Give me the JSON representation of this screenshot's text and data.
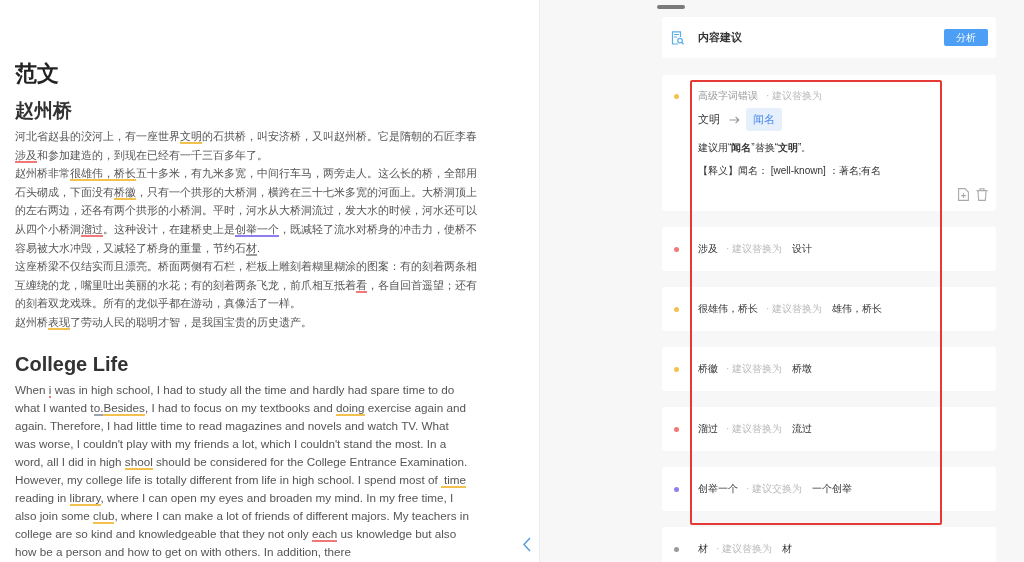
{
  "document": {
    "title": "范文",
    "sections": [
      {
        "heading": "赵州桥",
        "paragraphs": [
          {
            "segments": [
              {
                "kind": "plain",
                "text": "河北省赵县的洨河上，有一座世界"
              },
              {
                "kind": "error",
                "text": "文明",
                "color": "#f2c14e"
              },
              {
                "kind": "plain",
                "text": "的石拱桥，叫安济桥，又叫赵州桥。它是隋朝的石匠李春"
              },
              {
                "kind": "error",
                "text": "涉及",
                "color": "#f07878"
              },
              {
                "kind": "plain",
                "text": "和参加建造的，到现在已经有一千三百多年了。"
              }
            ]
          },
          {
            "segments": [
              {
                "kind": "plain",
                "text": "赵州桥非常"
              },
              {
                "kind": "error",
                "text": "很雄伟，桥长",
                "color": "#f2c14e"
              },
              {
                "kind": "plain",
                "text": "五十多米，有九米多宽，中间行车马，两旁走人。这么长的桥，全部用石头砌成，下面没有"
              },
              {
                "kind": "error",
                "text": "桥徽",
                "color": "#f2c14e"
              },
              {
                "kind": "plain",
                "text": "，只有一个拱形的大桥洞，横跨在三十七米多宽的河面上。大桥洞顶上的左右两边，还各有两个拱形的小桥洞。平时，河水从大桥洞流过，发大水的时候，河水还可以从四个小桥洞"
              },
              {
                "kind": "error",
                "text": "溜过",
                "color": "#f07878"
              },
              {
                "kind": "plain",
                "text": "。这种设计，在建桥史上是"
              },
              {
                "kind": "error",
                "text": "创举一个",
                "color": "#8f7ef0"
              },
              {
                "kind": "plain",
                "text": "，既减轻了流水对桥身的冲击力，使桥不容易被大水冲毁，又减轻了桥身的重量，节约石"
              },
              {
                "kind": "error",
                "text": "材",
                "color": "#9a9a9a"
              },
              {
                "kind": "plain",
                "text": "."
              }
            ]
          },
          {
            "segments": [
              {
                "kind": "plain",
                "text": "这座桥梁不仅结实而且漂亮。桥面两侧有石栏，栏板上雕刻着糊里糊涂的图案：有的刻着两条相互缠绕的龙，嘴里吐出美丽的水花；有的刻着两条飞龙，前爪相互抵着"
              },
              {
                "kind": "error",
                "text": "看",
                "color": "#f07878"
              },
              {
                "kind": "plain",
                "text": "，各自回首遥望；还有的刻着双龙戏珠。所有的龙似乎都在游动，真像活了一样。"
              }
            ]
          },
          {
            "segments": [
              {
                "kind": "plain",
                "text": "赵州桥"
              },
              {
                "kind": "error",
                "text": "表现",
                "color": "#f2c14e"
              },
              {
                "kind": "plain",
                "text": "了劳动人民的聪明才智，是我国宝贵的历史遗产。"
              }
            ]
          }
        ]
      },
      {
        "heading": "College Life",
        "paragraphs": [
          {
            "segments": [
              {
                "kind": "plain",
                "text": "When "
              },
              {
                "kind": "error",
                "text": "i",
                "color": "#f07878"
              },
              {
                "kind": "plain",
                "text": " was in high school, I had to study all the time and hardly had spare time to do what I wanted t"
              },
              {
                "kind": "error",
                "text": "o.",
                "color": "#9aa4b4"
              },
              {
                "kind": "error",
                "text": "Besides",
                "color": "#f2c14e"
              },
              {
                "kind": "plain",
                "text": ", I had to focus on my textbooks and "
              },
              {
                "kind": "error",
                "text": "doing",
                "color": "#f2c14e"
              },
              {
                "kind": "plain",
                "text": " exercise again and again. Therefore, I had little time to read magazines and novels and watch TV. What was worse, I couldn't play with my friends a lot, which I couldn't stand the most. In a word, all I did in high "
              },
              {
                "kind": "error",
                "text": "shool",
                "color": "#f2c14e"
              },
              {
                "kind": "plain",
                "text": " should be considered for the College Entrance Examination. However, my college life is totally different from life in high school. I spend most of "
              },
              {
                "kind": "insert",
                "color": "#f2c14e"
              },
              {
                "kind": "error",
                "text": "time",
                "color": "#f2c14e"
              },
              {
                "kind": "plain",
                "text": " reading in "
              },
              {
                "kind": "error",
                "text": "library",
                "color": "#f2c14e"
              },
              {
                "kind": "plain",
                "text": ", where I can open my eyes and broaden my mind. In my free time, I also join some "
              },
              {
                "kind": "error",
                "text": "club",
                "color": "#f2c14e"
              },
              {
                "kind": "plain",
                "text": ", where I can make a lot of friends of different majors. My teachers in college are so kind and knowledgeable that they not only "
              },
              {
                "kind": "error",
                "text": "each",
                "color": "#f07878"
              },
              {
                "kind": "plain",
                "text": " us knowledge but also how be a person and how to get on with others. In addition, there"
              }
            ]
          }
        ]
      }
    ]
  },
  "panel": {
    "header": {
      "title": "内容建议",
      "button": "分析"
    },
    "cards": [
      {
        "kind": "detail",
        "color": "#f2c14e",
        "category": "高级字词错误",
        "hint": "· 建议替换为",
        "original": "文明",
        "replacement": "闻名",
        "advice": "建议用“**闻名**”替换“**文明**”。",
        "definition": "【释义】闻名： [well-known] ：著名;有名"
      },
      {
        "kind": "compact",
        "color": "#f07878",
        "original": "涉及",
        "hint": "· 建议替换为",
        "replacement": "设计"
      },
      {
        "kind": "compact",
        "color": "#f2c14e",
        "original": "很雄伟，桥长",
        "hint": "· 建议替换为",
        "replacement": "雄伟，桥长"
      },
      {
        "kind": "compact",
        "color": "#f2c14e",
        "original": "桥徽",
        "hint": "· 建议替换为",
        "replacement": "桥墩"
      },
      {
        "kind": "compact",
        "color": "#f07878",
        "original": "溜过",
        "hint": "· 建议替换为",
        "replacement": "流过"
      },
      {
        "kind": "compact",
        "color": "#8f7ef0",
        "original": "创举一个",
        "hint": "· 建议交换为",
        "replacement": "一个创举"
      },
      {
        "kind": "compact",
        "color": "#9a9a9a",
        "original": "材",
        "hint": "· 建议替换为",
        "replacement": "材"
      }
    ]
  }
}
